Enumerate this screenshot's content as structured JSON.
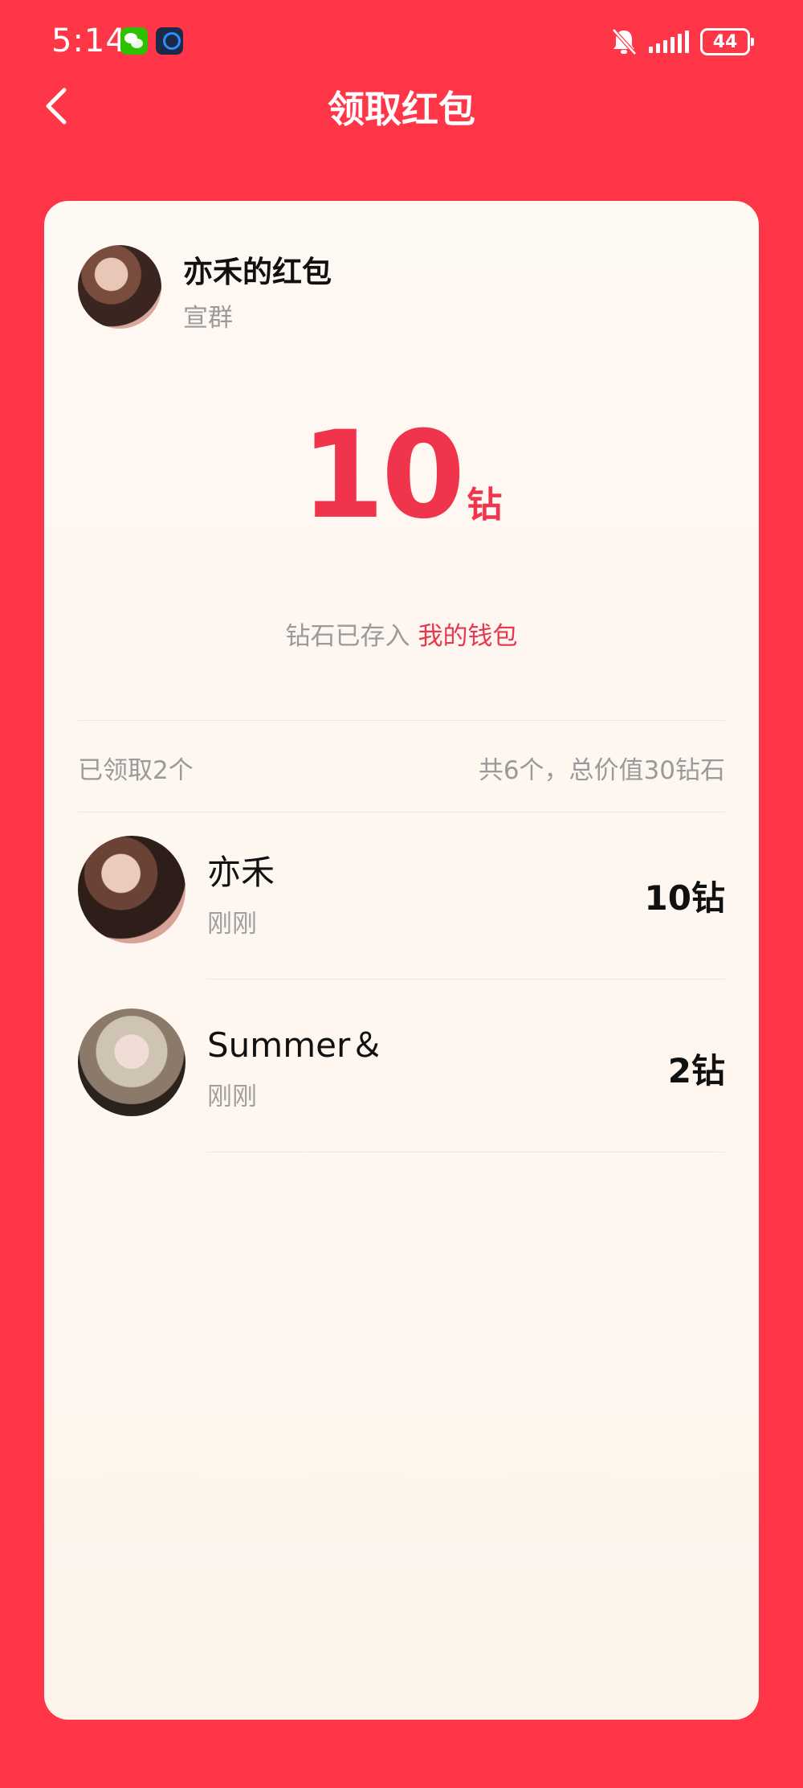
{
  "status_bar": {
    "time": "5:14",
    "battery": "44",
    "icons": [
      "wechat-icon",
      "app-icon",
      "bell-off-icon",
      "signal-icon",
      "battery-icon"
    ]
  },
  "nav": {
    "title": "领取红包",
    "back_icon": "chevron-left-icon"
  },
  "sender": {
    "name": "亦禾的红包",
    "group": "宣群"
  },
  "amount": {
    "value": "10",
    "unit": "钻"
  },
  "wallet": {
    "prefix": "钻石已存入",
    "link": "我的钱包"
  },
  "summary": {
    "claimed": "已领取2个",
    "total": "共6个，总价值30钻石"
  },
  "claims": [
    {
      "name": "亦禾",
      "time": "刚刚",
      "amount": "10钻"
    },
    {
      "name": "Summer＆",
      "time": "刚刚",
      "amount": "2钻"
    }
  ],
  "colors": {
    "background": "#FF3548",
    "accent": "#F0344B",
    "card": "#FFF8F3"
  }
}
